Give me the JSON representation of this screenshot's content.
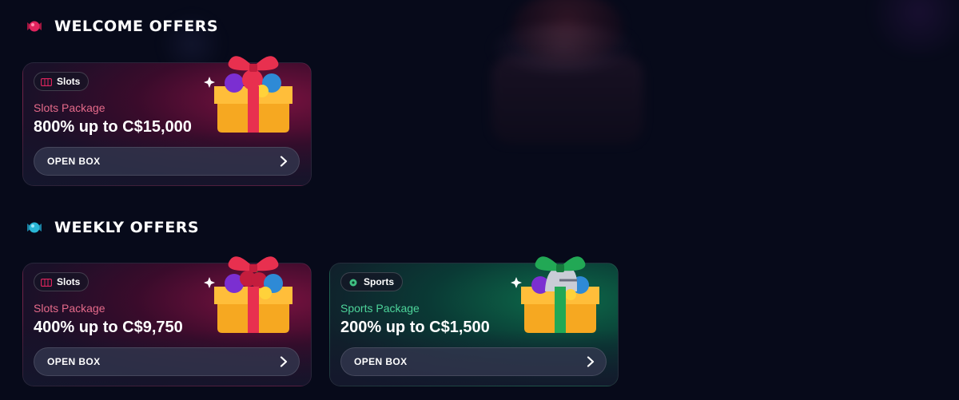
{
  "sections": {
    "welcome": {
      "title": "WELCOME OFFERS",
      "cards": [
        {
          "badge": "Slots",
          "package": "Slots Package",
          "amount": "800% up to C$15,000",
          "button": "OPEN BOX",
          "theme": "slots",
          "accent": "#e56a8a"
        }
      ]
    },
    "weekly": {
      "title": "WEEKLY OFFERS",
      "cards": [
        {
          "badge": "Slots",
          "package": "Slots Package",
          "amount": "400% up to C$9,750",
          "button": "OPEN BOX",
          "theme": "slots",
          "accent": "#e56a8a"
        },
        {
          "badge": "Sports",
          "package": "Sports Package",
          "amount": "200% up to C$1,500",
          "button": "OPEN BOX",
          "theme": "sports",
          "accent": "#4dd49a"
        }
      ]
    }
  },
  "icons": {
    "welcome_section": "candy-icon",
    "weekly_section": "candy-icon",
    "slots_badge": "slot-machine-icon",
    "sports_badge": "soccer-ball-icon",
    "open_button": "chevron-right-icon",
    "slots_gift": "gift-box-icon",
    "sports_gift": "gift-box-icon"
  },
  "colors": {
    "background": "#070a1a",
    "welcome_candy": "#e0245e",
    "weekly_candy": "#29b6d6",
    "slots_ribbon": "#e8304f",
    "sports_ribbon": "#22a855",
    "box": "#f6a821"
  }
}
